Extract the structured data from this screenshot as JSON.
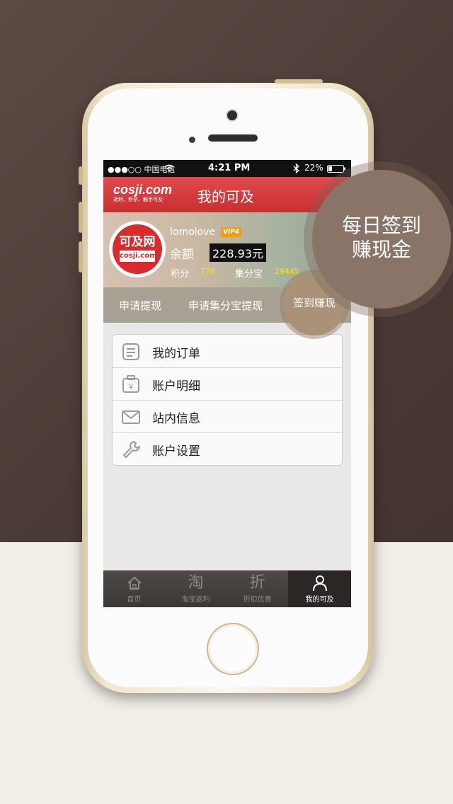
{
  "status_bar": {
    "carrier": "●●●○○ 中国电信",
    "time": "4:21 PM",
    "battery": "22%"
  },
  "header": {
    "logo_main": "cosji.com",
    "logo_sub": "返利、秒杀、触手可及",
    "title": "我的可及"
  },
  "profile": {
    "avatar_title": "可及网",
    "avatar_sub": "cosji.com",
    "username": "lomolove",
    "vip_label": "VIP4",
    "balance_label": "余额",
    "balance_value": "228.93元",
    "points_label": "积分",
    "points_value": "776",
    "jifenbao_label": "集分宝",
    "jifenbao_value": "29445"
  },
  "actions": {
    "withdraw": "申请提现",
    "withdraw_jfb": "申请集分宝提现",
    "checkin": "签到赚现"
  },
  "menu": [
    {
      "label": "我的订单",
      "icon": "order-list-icon"
    },
    {
      "label": "账户明细",
      "icon": "wallet-yuan-icon"
    },
    {
      "label": "站内信息",
      "icon": "mail-icon"
    },
    {
      "label": "账户设置",
      "icon": "wrench-icon"
    }
  ],
  "tabbar": [
    {
      "label": "首页",
      "icon": "home-icon"
    },
    {
      "label": "淘宝返利",
      "icon": "taobao-icon",
      "glyph": "淘"
    },
    {
      "label": "折扣优惠",
      "icon": "discount-icon",
      "glyph": "折"
    },
    {
      "label": "我的可及",
      "icon": "user-icon",
      "active": true
    }
  ],
  "promo": {
    "line1": "每日签到",
    "line2": "赚现金"
  },
  "colors": {
    "brand_red": "#d83a3a",
    "promo_brown": "#8a7468",
    "points_yellow": "#ffe000",
    "vip_orange": "#f39c19"
  }
}
